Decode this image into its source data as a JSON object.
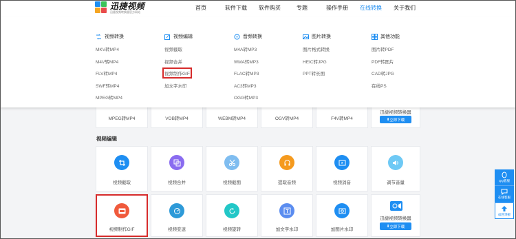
{
  "header": {
    "logo_name": "迅捷视频",
    "logo_sub": "迅捷视频转换器官方网站",
    "nav": [
      "首页",
      "软件下载",
      "软件购买",
      "专题",
      "操作手册",
      "在线转换",
      "关于我们"
    ],
    "active_nav": "在线转换"
  },
  "menu": {
    "columns": [
      {
        "title": "视频转换",
        "icon": "video-convert-icon",
        "items": [
          "MKV转MP4",
          "M4V转MP4",
          "FLV转MP4",
          "SWF转MP4",
          "MPEG转MP4"
        ]
      },
      {
        "title": "视频编辑",
        "icon": "video-edit-icon",
        "items": [
          "视频截取",
          "视频合并",
          "视频制作GIF",
          "加文字水印"
        ]
      },
      {
        "title": "音频转换",
        "icon": "audio-convert-icon",
        "items": [
          "M4A转MP3",
          "WMA转MP3",
          "FLAC转MP3",
          "AC3转MP3",
          "OGG转MP3"
        ]
      },
      {
        "title": "图片转换",
        "icon": "image-convert-icon",
        "items": [
          "图片格式转换",
          "HEIC转JPG",
          "PPT转长图"
        ]
      },
      {
        "title": "其他功能",
        "icon": "other-icon",
        "items": [
          "图片转PDF",
          "PDF转图片",
          "CAD转JPG",
          "在线PS"
        ]
      }
    ],
    "highlighted_item": "视频制作GIF"
  },
  "top_row": {
    "cards": [
      "MPEG转MP4",
      "VOB转MP4",
      "WEBM转MP4",
      "OGV转MP4",
      "F4V转MP4"
    ],
    "promo_title": "迅捷视频转换器",
    "download_label": "立即下载"
  },
  "section": {
    "title": "视频编辑",
    "row_a": [
      {
        "label": "视频截取",
        "icon": "crop-icon",
        "color": "#1e8ef2"
      },
      {
        "label": "视频合并",
        "icon": "merge-icon",
        "color": "#8a6cf0"
      },
      {
        "label": "视频截图",
        "icon": "scissors-icon",
        "color": "#7fbdf0"
      },
      {
        "label": "提取音频",
        "icon": "headphones-icon",
        "color": "#f59a1e"
      },
      {
        "label": "视频消音",
        "icon": "play-icon",
        "color": "#1e8ef2"
      },
      {
        "label": "调节音量",
        "icon": "volume-icon",
        "color": "#6ec9f5"
      }
    ],
    "row_b": [
      {
        "label": "视频制作GIF",
        "icon": "gif-icon",
        "color": "#f05a3c"
      },
      {
        "label": "视频变速",
        "icon": "speed-icon",
        "color": "#2e9ad8"
      },
      {
        "label": "视频旋转",
        "icon": "rotate-icon",
        "color": "#22c7c7"
      },
      {
        "label": "加文字水印",
        "icon": "text-watermark-icon",
        "color": "#5b8df0"
      },
      {
        "label": "加图片水印",
        "icon": "image-watermark-icon",
        "color": "#1e8ef2"
      }
    ],
    "promo_title": "迅捷视频转换器",
    "download_label": "立即下载"
  },
  "side": {
    "qq": "QQ客服",
    "online": "在线客服",
    "top": "返回顶部"
  },
  "colors": {
    "brand": "#1e8ef2",
    "highlight": "#d62b2b"
  }
}
